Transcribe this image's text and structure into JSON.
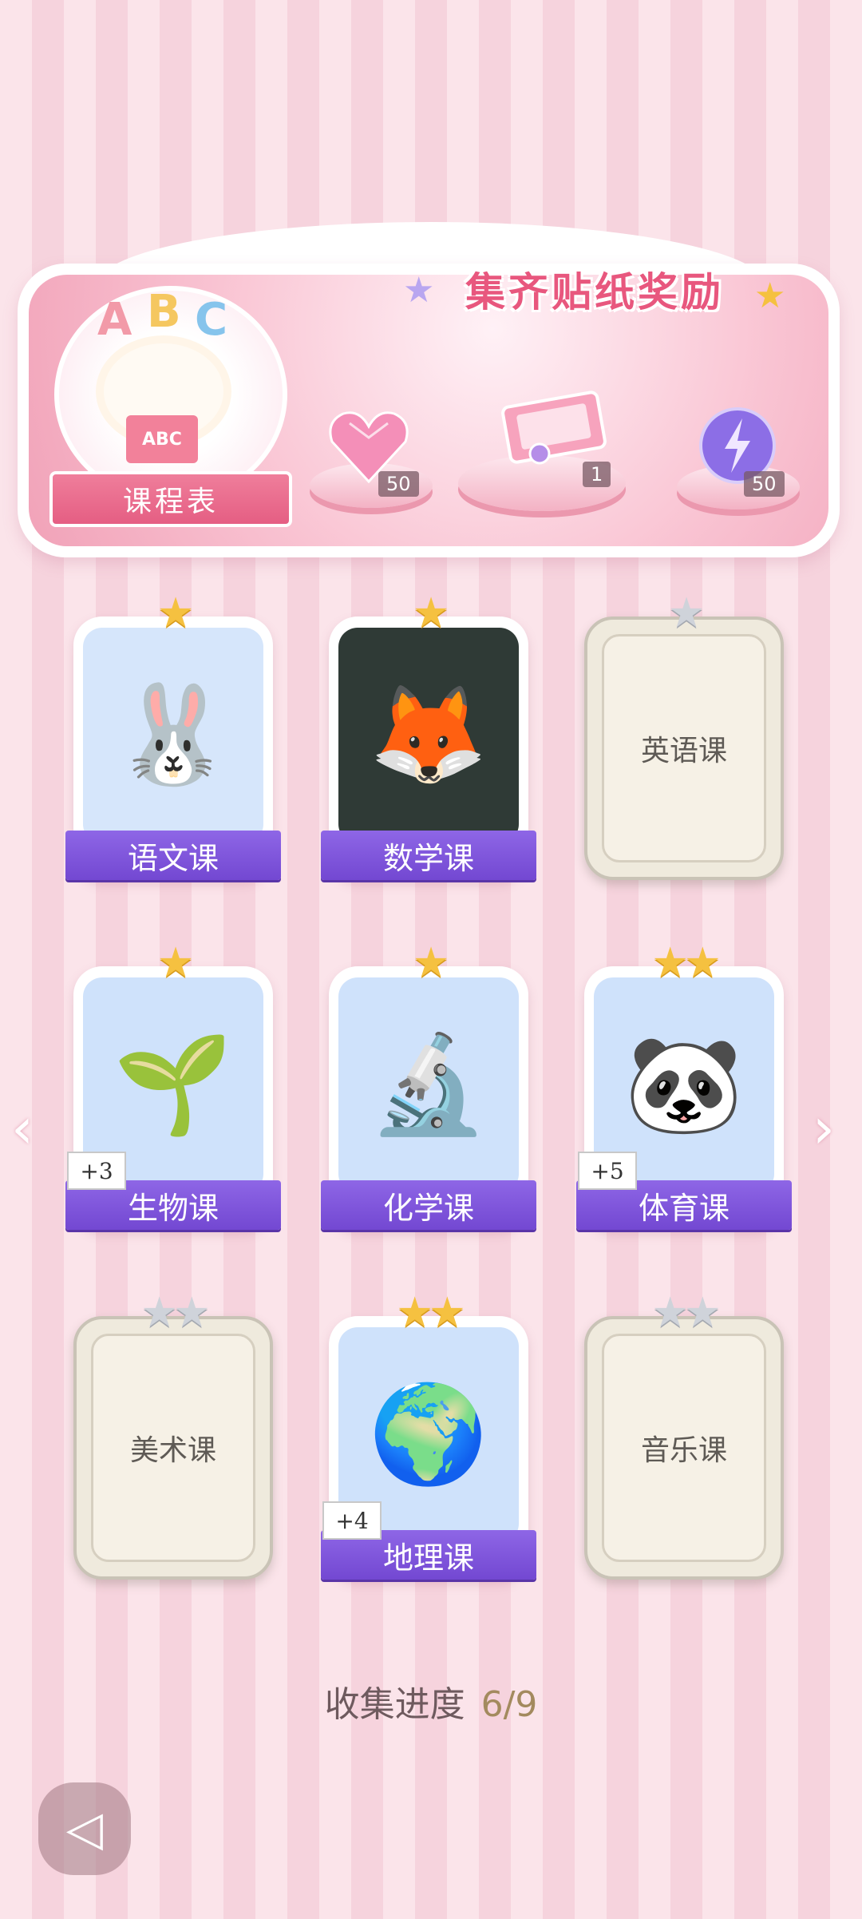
{
  "banner": {
    "title": "集齐贴纸奖励",
    "schedule_label": "课程表",
    "book_text": "ABC",
    "abc_letters": [
      "A",
      "B",
      "C"
    ],
    "rewards": [
      {
        "icon": "pink-heart-gem-icon",
        "count": "50"
      },
      {
        "icon": "gift-box-icon",
        "count": "1"
      },
      {
        "icon": "lightning-orb-icon",
        "count": "50"
      }
    ]
  },
  "courses": [
    {
      "label": "语文课",
      "stars": 1,
      "earned": 1,
      "unlocked": true,
      "bonus": ""
    },
    {
      "label": "数学课",
      "stars": 1,
      "earned": 1,
      "unlocked": true,
      "bonus": ""
    },
    {
      "label": "英语课",
      "stars": 1,
      "earned": 0,
      "unlocked": false,
      "bonus": ""
    },
    {
      "label": "生物课",
      "stars": 1,
      "earned": 1,
      "unlocked": true,
      "bonus": "+3"
    },
    {
      "label": "化学课",
      "stars": 1,
      "earned": 1,
      "unlocked": true,
      "bonus": ""
    },
    {
      "label": "体育课",
      "stars": 2,
      "earned": 2,
      "unlocked": true,
      "bonus": "+5"
    },
    {
      "label": "美术课",
      "stars": 2,
      "earned": 0,
      "unlocked": false,
      "bonus": ""
    },
    {
      "label": "地理课",
      "stars": 2,
      "earned": 2,
      "unlocked": true,
      "bonus": "+4"
    },
    {
      "label": "音乐课",
      "stars": 2,
      "earned": 0,
      "unlocked": false,
      "bonus": ""
    }
  ],
  "progress": {
    "label": "收集进度",
    "value": "6/9"
  },
  "colors": {
    "accent_pink": "#e8577e",
    "label_purple": "#7f57dc",
    "star_gold": "#f5c140",
    "star_gray": "#cfd3da"
  }
}
